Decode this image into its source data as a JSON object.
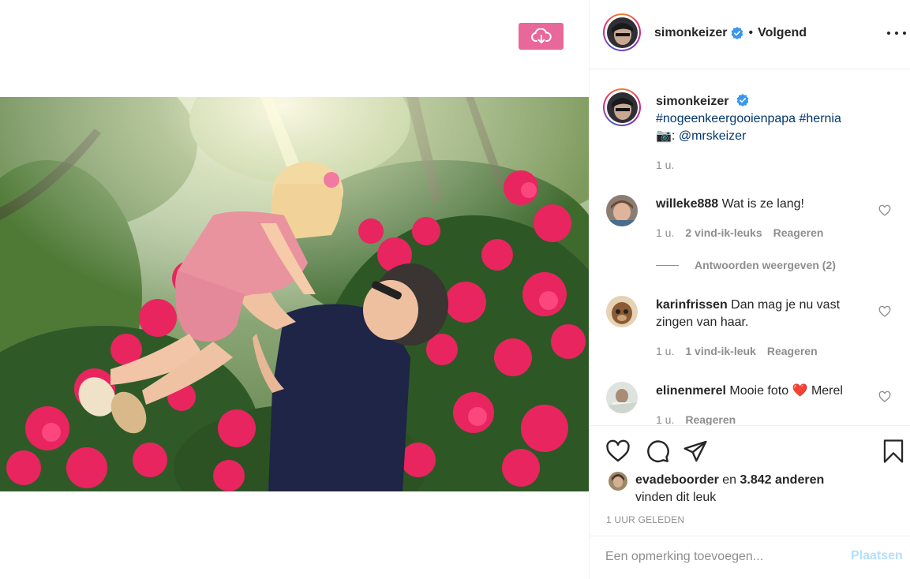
{
  "toolbar": {
    "download_icon": "cloud-download-icon",
    "download_color": "#e8689a"
  },
  "post": {
    "author": "simonkeizer",
    "separator": "•",
    "follow_status": "Volgend",
    "more_icon": "more-options-icon"
  },
  "caption": {
    "author": "simonkeizer",
    "hashtags": "#nogeenkeergooienpapa #hernia",
    "camera_emoji": "📷",
    "credit_prefix": ":",
    "mention": "@mrskeizer",
    "time": "1 u."
  },
  "comments": [
    {
      "user": "willeke888",
      "text": "Wat is ze lang!",
      "time": "1 u.",
      "likes": "2 vind-ik-leuks",
      "reply": "Reageren"
    },
    {
      "user": "karinfrissen",
      "text_line1": "Dan mag je nu vast",
      "text_line2": "zingen van haar.",
      "time": "1 u.",
      "likes": "1 vind-ik-leuk",
      "reply": "Reageren"
    },
    {
      "user": "elinenmerel",
      "text_before": "Mooie foto",
      "heart": "❤️",
      "text_after": "Merel",
      "time": "1 u.",
      "reply": "Reageren"
    }
  ],
  "view_replies": "Antwoorden weergeven (2)",
  "likes": {
    "user": "evadeboorder",
    "connector": "en",
    "count": "3.842 anderen",
    "suffix": "vinden dit leuk"
  },
  "timestamp": "1 UUR GELEDEN",
  "add_comment": {
    "placeholder": "Een opmerking toevoegen...",
    "post_label": "Plaatsen"
  },
  "colors": {
    "link": "#00376b",
    "muted": "#8e8e8e",
    "verified": "#3897f0",
    "post_disabled": "#b2dffc"
  }
}
